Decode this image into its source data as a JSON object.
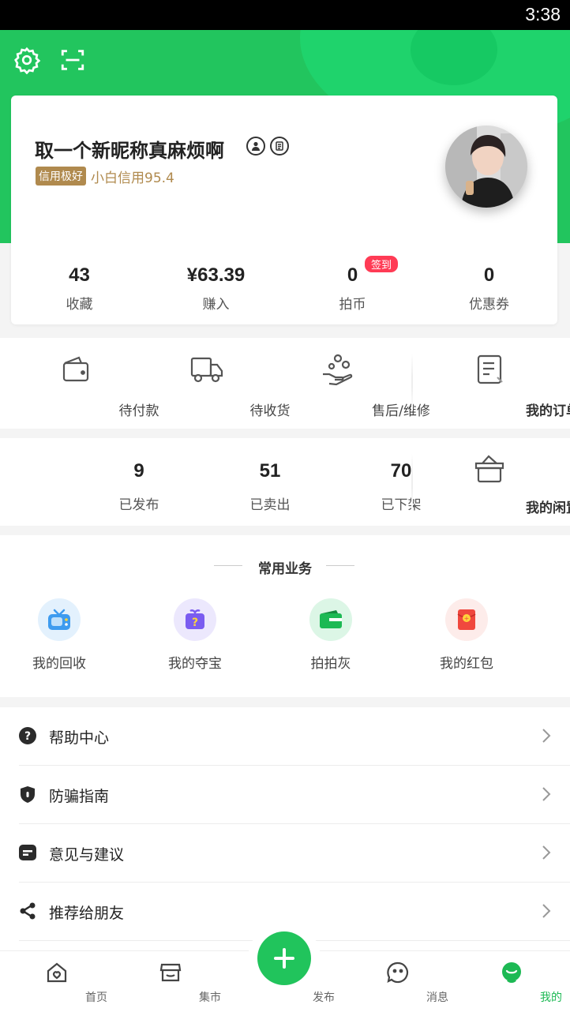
{
  "status": {
    "time": "3:38"
  },
  "profile": {
    "nickname": "取一个新昵称真麻烦啊",
    "credit_tag": "信用极好",
    "credit_text": "小白信用95.4"
  },
  "stats": [
    {
      "value": "43",
      "label": "收藏"
    },
    {
      "value": "¥63.39",
      "label": "赚入"
    },
    {
      "value": "0",
      "label": "拍币"
    },
    {
      "value": "0",
      "label": "优惠券"
    }
  ],
  "signin_badge": "签到",
  "orders": {
    "items": [
      {
        "label": "待付款",
        "icon": "wallet-icon"
      },
      {
        "label": "待收货",
        "icon": "truck-icon"
      },
      {
        "label": "售后/维修",
        "icon": "hand-coins-icon"
      }
    ],
    "main": {
      "label": "我的订单",
      "icon": "order-document-icon"
    }
  },
  "listings": {
    "items": [
      {
        "value": "9",
        "label": "已发布"
      },
      {
        "value": "51",
        "label": "已卖出"
      },
      {
        "value": "70",
        "label": "已下架"
      }
    ],
    "main": {
      "label": "我的闲置",
      "icon": "box-icon"
    }
  },
  "services": {
    "title": "常用业务",
    "items": [
      {
        "label": "我的回收",
        "icon": "tv-icon",
        "color": "#4aa3f0"
      },
      {
        "label": "我的夺宝",
        "icon": "mystery-box-icon",
        "color": "#7a5cf0"
      },
      {
        "label": "拍拍灰",
        "icon": "green-wallet-icon",
        "color": "#1db954"
      },
      {
        "label": "我的红包",
        "icon": "red-envelope-icon",
        "color": "#f0483e"
      }
    ]
  },
  "menu": [
    {
      "label": "帮助中心",
      "icon": "help-icon"
    },
    {
      "label": "防骗指南",
      "icon": "shield-icon"
    },
    {
      "label": "意见与建议",
      "icon": "feedback-icon"
    },
    {
      "label": "推荐给朋友",
      "icon": "share-icon"
    }
  ],
  "tabs": [
    {
      "label": "首页",
      "icon": "home-icon"
    },
    {
      "label": "集市",
      "icon": "market-icon"
    },
    {
      "label": "发布",
      "icon": "plus-icon"
    },
    {
      "label": "消息",
      "icon": "message-icon"
    },
    {
      "label": "我的",
      "icon": "profile-icon"
    }
  ],
  "colors": {
    "accent": "#22c55e",
    "credit": "#b08a4e",
    "signin": "#ff3b55"
  }
}
